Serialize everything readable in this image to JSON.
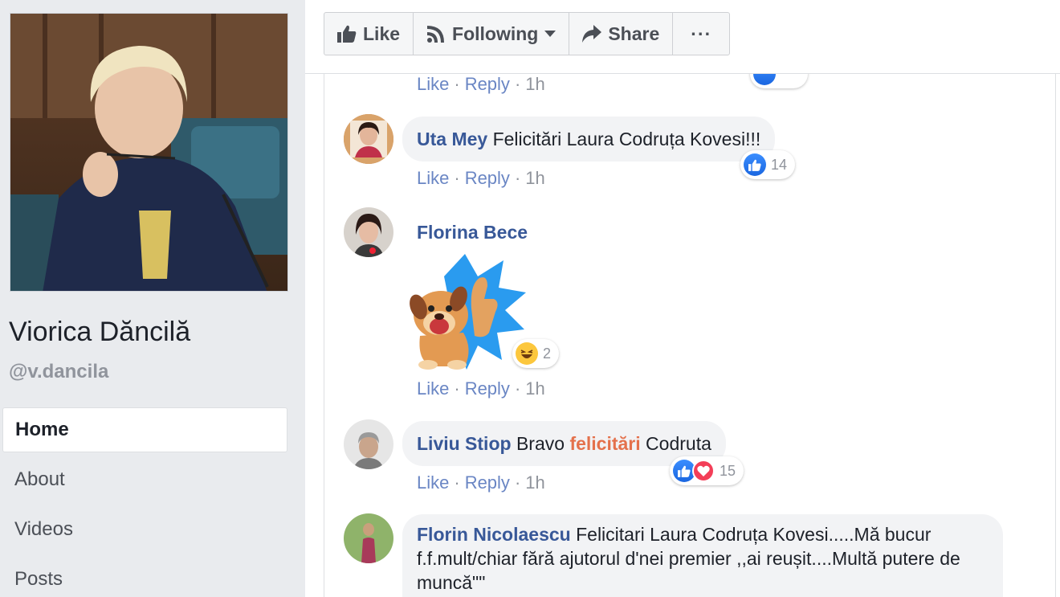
{
  "page": {
    "name": "Viorica Dăncilă",
    "handle": "@v.dancila"
  },
  "nav": {
    "items": [
      {
        "label": "Home"
      },
      {
        "label": "About"
      },
      {
        "label": "Videos"
      },
      {
        "label": "Posts"
      }
    ]
  },
  "toolbar": {
    "like_label": "Like",
    "following_label": "Following",
    "share_label": "Share",
    "more_label": "···"
  },
  "comment_actions": {
    "like": "Like",
    "reply": "Reply",
    "sep": "·"
  },
  "comments": [
    {
      "time": "1h"
    },
    {
      "author": "Uta Mey",
      "text": "Felicitări Laura Codruța Kovesi!!!",
      "reactions": "14",
      "time": "1h"
    },
    {
      "author": "Florina Bece",
      "reactions": "2",
      "time": "1h"
    },
    {
      "author": "Liviu Stiop",
      "text_before": "Bravo",
      "highlight": "felicitări",
      "text_after": "Codruta",
      "reactions": "15",
      "time": "1h"
    },
    {
      "author": "Florin Nicolaescu",
      "text": "Felicitari Laura Codruța Kovesi.....Mă bucur f.f.mult/chiar fără ajutorul d'nei premier ,,ai reușit....Multă putere de muncă\"\""
    }
  ],
  "colors": {
    "link": "#385898",
    "action": "#6a86c4",
    "like_blue": "#1877f2",
    "highlight": "#e4714c"
  }
}
